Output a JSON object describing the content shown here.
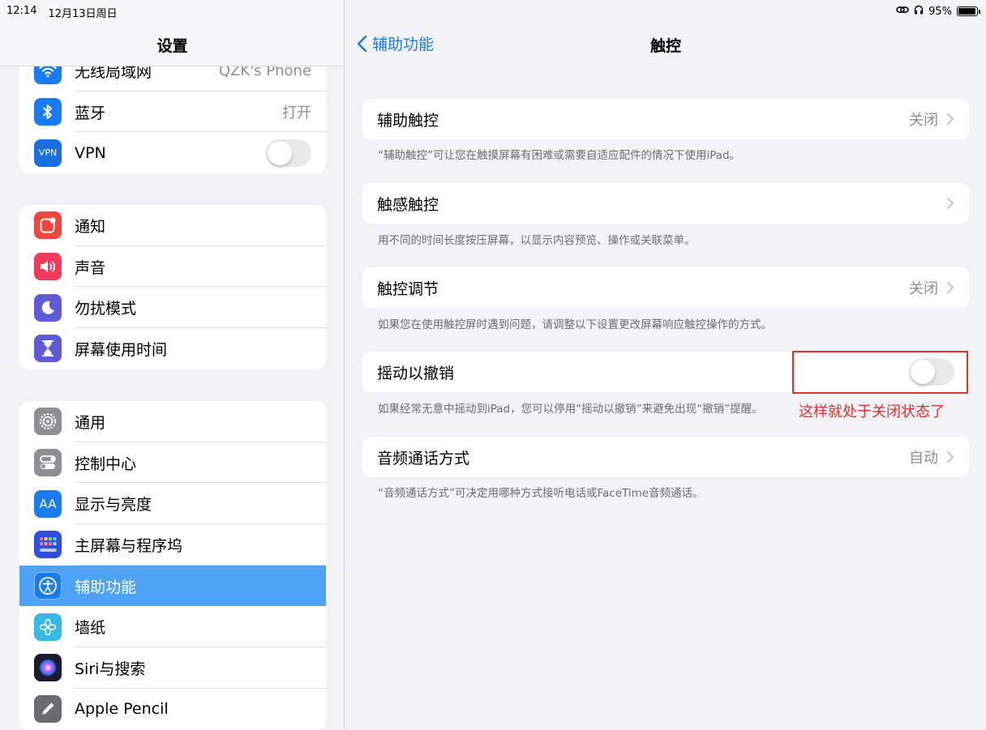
{
  "status_bar": {
    "time": "12:14",
    "date": "12月13日周日",
    "battery": "95%",
    "battery_level": 0.95
  },
  "sidebar": {
    "title": "设置",
    "groups": [
      {
        "items": [
          {
            "label": "无线局域网",
            "value": "QZK's Phone",
            "icon": "wifi-icon",
            "color": "#1a7cf5"
          },
          {
            "label": "蓝牙",
            "value": "打开",
            "icon": "bluetooth-icon",
            "color": "#1a7cf5"
          },
          {
            "label": "VPN",
            "icon": "vpn-icon",
            "icon_text": "VPN",
            "color": "#1a6fe0",
            "toggle": false
          }
        ]
      },
      {
        "items": [
          {
            "label": "通知",
            "icon": "notification-icon",
            "color": "#f2453d"
          },
          {
            "label": "声音",
            "icon": "sound-icon",
            "color": "#f23a5c"
          },
          {
            "label": "勿扰模式",
            "icon": "moon-icon",
            "color": "#5f5ad6"
          },
          {
            "label": "屏幕使用时间",
            "icon": "hourglass-icon",
            "color": "#5f5ad6"
          }
        ]
      },
      {
        "items": [
          {
            "label": "通用",
            "icon": "gear-icon",
            "color": "#8e8e93"
          },
          {
            "label": "控制中心",
            "icon": "control-center-icon",
            "color": "#8e8e93"
          },
          {
            "label": "显示与亮度",
            "icon": "display-icon",
            "icon_text": "AA",
            "color": "#1a7cf5"
          },
          {
            "label": "主屏幕与程序坞",
            "icon": "home-screen-icon",
            "color": "#2f4fe0"
          },
          {
            "label": "辅助功能",
            "icon": "accessibility-icon",
            "color": "#1a7cf5",
            "selected": true
          },
          {
            "label": "墙纸",
            "icon": "wallpaper-icon",
            "color": "#35b9e6"
          },
          {
            "label": "Siri与搜索",
            "icon": "siri-icon",
            "color": "#1c1c2e"
          },
          {
            "label": "Apple Pencil",
            "icon": "pencil-icon",
            "color": "#6b6b70"
          }
        ]
      }
    ]
  },
  "detail": {
    "back_label": "辅助功能",
    "title": "触控",
    "rows": [
      {
        "label": "辅助触控",
        "value": "关闭",
        "chevron": true,
        "footnote": "“辅助触控”可让您在触摸屏幕有困难或需要自适应配件的情况下使用iPad。"
      },
      {
        "label": "触感触控",
        "value": "",
        "chevron": true,
        "footnote": "用不同的时间长度按压屏幕，以显示内容预览、操作或关联菜单。"
      },
      {
        "label": "触控调节",
        "value": "关闭",
        "chevron": true,
        "footnote": "如果您在使用触控屏时遇到问题，请调整以下设置更改屏幕响应触控操作的方式。"
      },
      {
        "label": "摇动以撤销",
        "toggle": false,
        "footnote": "如果经常无意中摇动到iPad，您可以停用“摇动以撤销”来避免出现“撤销”提醒。"
      },
      {
        "label": "音频通话方式",
        "value": "自动",
        "chevron": true,
        "footnote": "“音频通话方式”可决定用哪种方式接听电话或FaceTime音频通话。"
      }
    ]
  },
  "annotation": {
    "text": "这样就处于关闭状态了",
    "color": "#e5302e"
  }
}
